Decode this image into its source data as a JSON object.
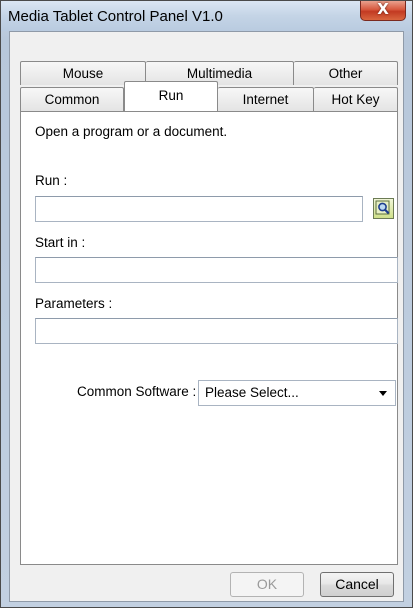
{
  "window": {
    "title": "Media Tablet Control Panel V1.0",
    "close_label": "X"
  },
  "tabs": {
    "top_row": [
      {
        "label": "Mouse"
      },
      {
        "label": "Multimedia"
      },
      {
        "label": "Other"
      }
    ],
    "bottom_row": [
      {
        "label": "Common"
      },
      {
        "label": "Run",
        "active": true
      },
      {
        "label": "Internet"
      },
      {
        "label": "Hot Key"
      }
    ]
  },
  "run_tab": {
    "description": "Open a program or a document.",
    "run_label": "Run :",
    "run_value": "",
    "start_in_label": "Start in :",
    "start_in_value": "",
    "parameters_label": "Parameters :",
    "parameters_value": "",
    "common_software_label": "Common Software :",
    "common_software_selected": "Please Select..."
  },
  "buttons": {
    "ok_label": "OK",
    "ok_enabled": false,
    "cancel_label": "Cancel"
  },
  "icons": {
    "browse": "magnifier-icon",
    "close": "close-icon",
    "dropdown": "chevron-down-icon"
  }
}
